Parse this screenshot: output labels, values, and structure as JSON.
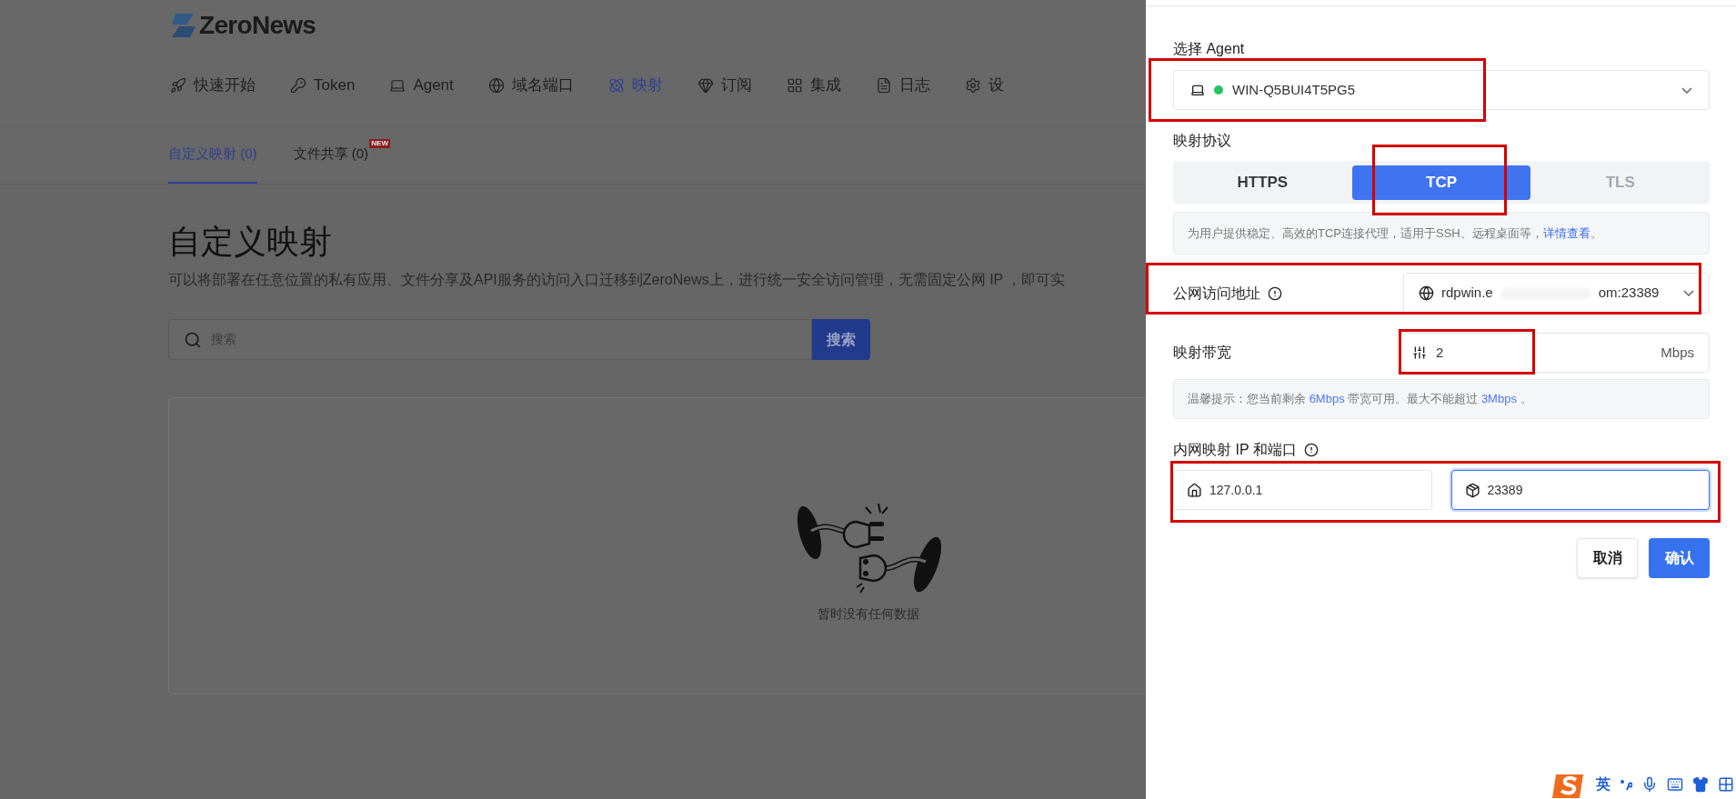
{
  "brand": {
    "name": "ZeroNews"
  },
  "nav": [
    {
      "label": "快速开始",
      "selected": false
    },
    {
      "label": "Token",
      "selected": false
    },
    {
      "label": "Agent",
      "selected": false
    },
    {
      "label": "域名端口",
      "selected": false
    },
    {
      "label": "映射",
      "selected": true
    },
    {
      "label": "订阅",
      "selected": false
    },
    {
      "label": "集成",
      "selected": false
    },
    {
      "label": "日志",
      "selected": false
    },
    {
      "label": "设",
      "selected": false
    }
  ],
  "subtabs": [
    {
      "label": "自定义映射 (0)",
      "selected": true
    },
    {
      "label": "文件共享 (0)",
      "selected": false,
      "badge": "NEW"
    }
  ],
  "page": {
    "title": "自定义映射",
    "description": "可以将部署在任意位置的私有应用、文件分享及API服务的访问入口迁移到ZeroNews上，进行统一安全访问管理，无需固定公网 IP ，即可实",
    "search": {
      "placeholder": "搜索",
      "button": "搜索"
    },
    "empty_text": "暂时没有任何数据"
  },
  "drawer": {
    "agent": {
      "label": "选择 Agent",
      "value": "WIN-Q5BUI4T5PG5",
      "online": true
    },
    "protocol": {
      "label": "映射协议",
      "options": [
        {
          "label": "HTTPS",
          "selected": false,
          "disabled": false
        },
        {
          "label": "TCP",
          "selected": true,
          "disabled": false
        },
        {
          "label": "TLS",
          "selected": false,
          "disabled": true
        }
      ],
      "info": [
        {
          "kind": "text",
          "text": "为用户提供稳定、高效的TCP连接代理，适用于SSH、远程桌面等，"
        },
        {
          "kind": "link",
          "text": "详情查看"
        },
        {
          "kind": "text",
          "text": "。"
        }
      ]
    },
    "public_address": {
      "label": "公网访问地址",
      "value_start": "rdpwin.e",
      "value_end": "om:23389"
    },
    "bandwidth": {
      "label": "映射带宽",
      "value": "2",
      "unit": "Mbps",
      "tip": [
        {
          "kind": "text",
          "text": "温馨提示：您当前剩余 "
        },
        {
          "kind": "highlight",
          "text": "6Mbps"
        },
        {
          "kind": "text",
          "text": " 带宽可用。最大不能超过 "
        },
        {
          "kind": "highlight",
          "text": "3Mbps"
        },
        {
          "kind": "text",
          "text": " 。"
        }
      ]
    },
    "internal": {
      "label": "内网映射 IP 和端口",
      "ip": "127.0.0.1",
      "port": "23389",
      "port_focused": true
    },
    "buttons": [
      {
        "label": "取消",
        "kind": "secondary"
      },
      {
        "label": "确认",
        "kind": "primary"
      }
    ]
  },
  "highlight_frames": [
    {
      "kind": "agent"
    },
    {
      "kind": "protocol"
    },
    {
      "kind": "address"
    },
    {
      "kind": "bandwidth"
    },
    {
      "kind": "internal"
    }
  ],
  "ime_toolbar": {
    "language": "英"
  }
}
